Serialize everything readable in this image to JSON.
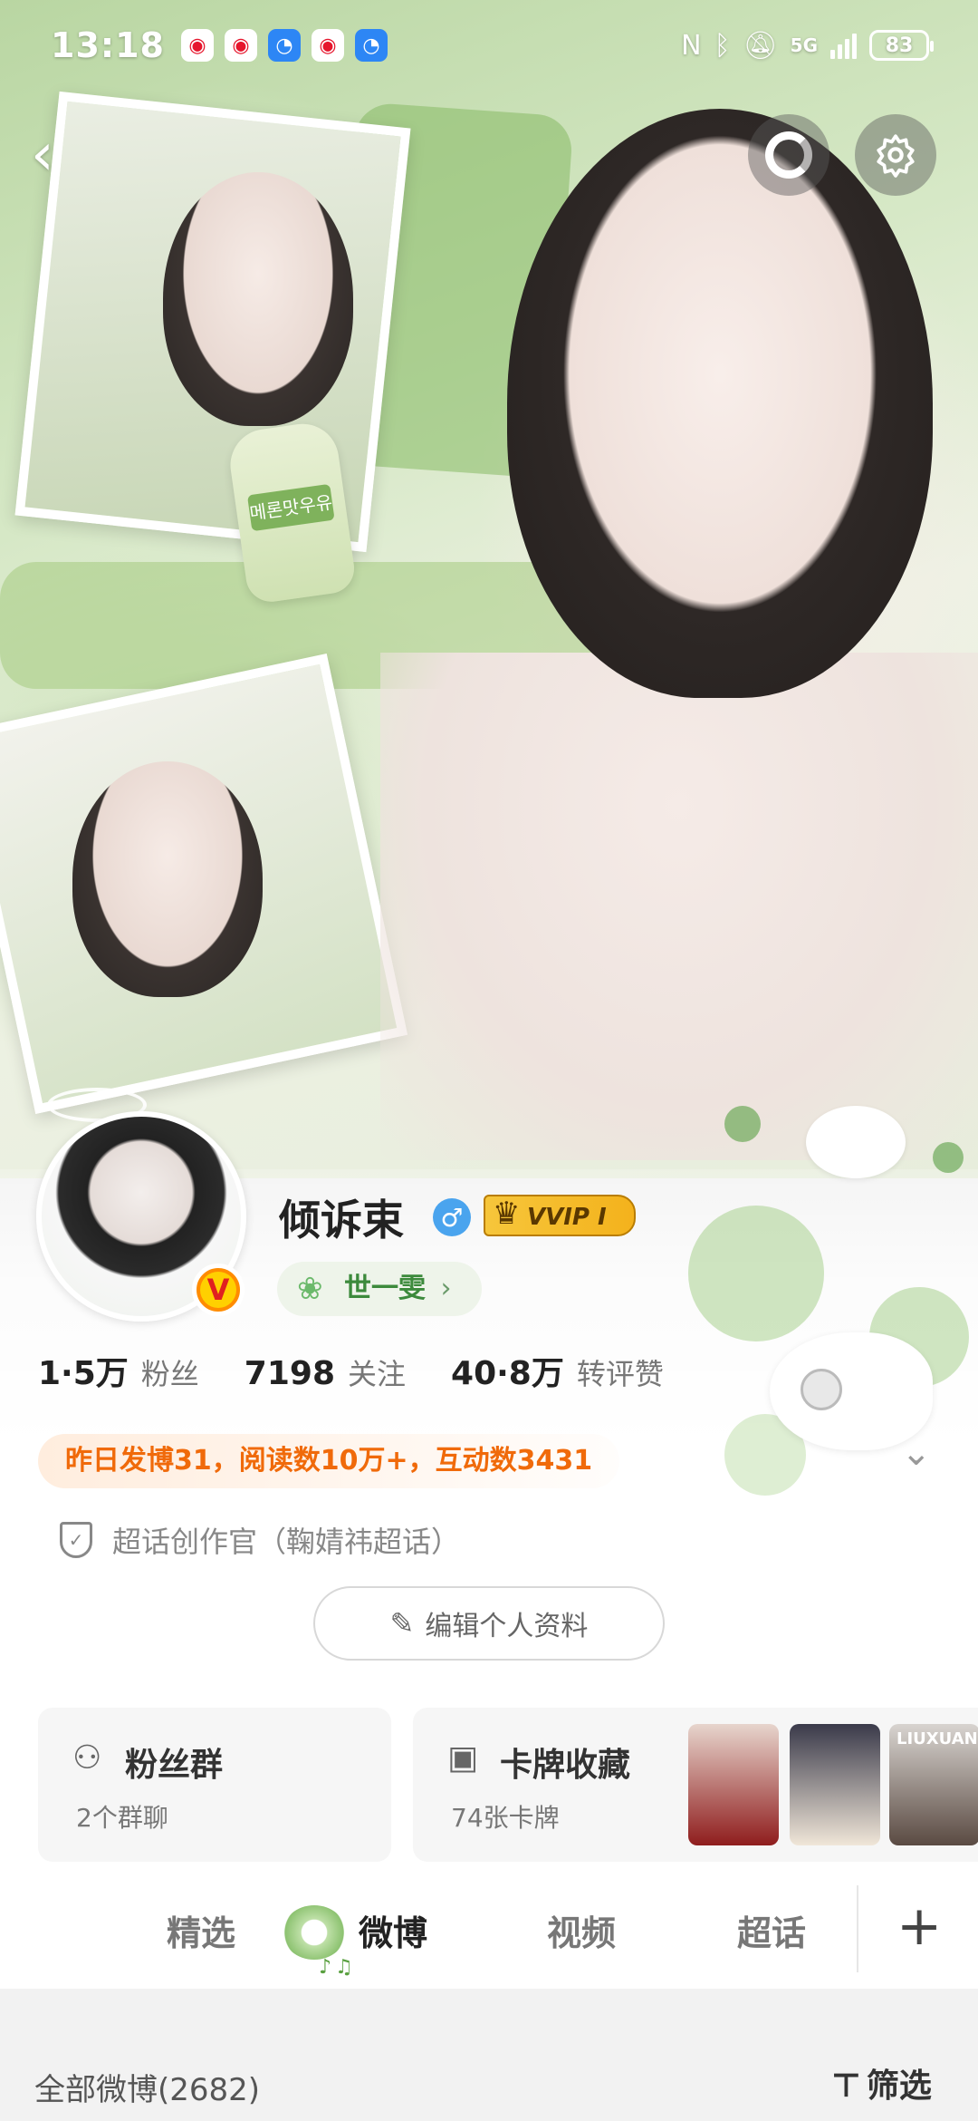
{
  "status_bar": {
    "time": "13:18",
    "notifications": [
      "weibo-icon",
      "weibo-icon",
      "app-icon",
      "weibo-icon",
      "app-icon"
    ],
    "right_icons": [
      "nfc-icon",
      "bluetooth-icon",
      "mute-icon",
      "5g-icon",
      "signal-icon"
    ],
    "network": "5G",
    "battery": "83"
  },
  "hero": {
    "bottle_label": "메론맛우유"
  },
  "profile": {
    "username": "倾诉束",
    "gender_symbol": "♂",
    "vip_label": "VVIP I",
    "title": "世一雯",
    "title_chevron": "›",
    "stats": [
      {
        "value": "1·5万",
        "label": "粉丝"
      },
      {
        "value": "7198",
        "label": "关注"
      },
      {
        "value": "40·8万",
        "label": "转评赞"
      }
    ],
    "activity": "昨日发博31，阅读数10万+，互动数3431",
    "supertopic": "超话创作官（鞠婧祎超话）",
    "edit_button": "编辑个人资料",
    "verified_badge": "V"
  },
  "cards": {
    "fans_group": {
      "title": "粉丝群",
      "subtitle": "2个群聊",
      "icon": "people-icon"
    },
    "card_collection": {
      "title": "卡牌收藏",
      "subtitle": "74张卡牌",
      "icon": "card-icon"
    },
    "preview_text": "LIUXUAN"
  },
  "tabs": [
    {
      "label": "精选"
    },
    {
      "label": "微博"
    },
    {
      "label": "视频"
    },
    {
      "label": "超话"
    }
  ],
  "add_tab": "+",
  "list": {
    "header": "全部微博(2682)",
    "filter_label": "筛选"
  },
  "colors": {
    "accent_orange": "#f06a0a",
    "title_green": "#3c8a3c",
    "vip_gold": "#f6c63b",
    "gender_blue": "#4aa4ee"
  }
}
